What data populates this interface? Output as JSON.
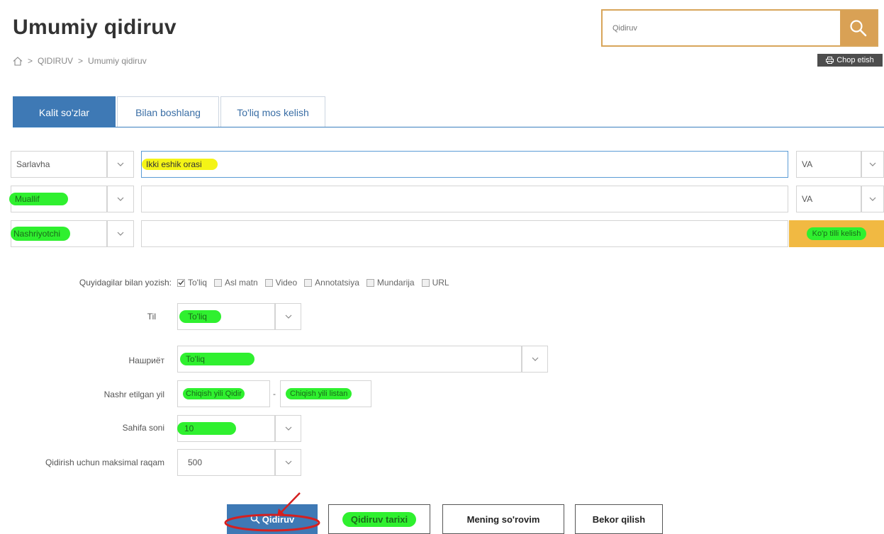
{
  "header": {
    "title": "Umumiy qidiruv",
    "breadcrumb": [
      "QIDIRUV",
      "Umumiy qidiruv"
    ],
    "breadcrumb_sep": ">",
    "search_placeholder": "Qidiruv",
    "print_label": "Chop etish"
  },
  "tabs": [
    {
      "label": "Kalit so'zlar",
      "active": true
    },
    {
      "label": "Bilan boshlang",
      "active": false
    },
    {
      "label": "To'liq mos kelish",
      "active": false
    }
  ],
  "criteria": [
    {
      "field": "Sarlavha",
      "value": "Ikki eshik orasi",
      "operator": "VA"
    },
    {
      "field": "Muallif",
      "value": "",
      "operator": "VA"
    },
    {
      "field": "Nashriyotchi",
      "value": "",
      "operator": "Ko'p tilli kelish"
    }
  ],
  "write_with": {
    "label": "Quyidagilar bilan yozish:",
    "options": [
      {
        "label": "To'liq",
        "checked": true
      },
      {
        "label": "Asl matn",
        "checked": false
      },
      {
        "label": "Video",
        "checked": false
      },
      {
        "label": "Annotatsiya",
        "checked": false
      },
      {
        "label": "Mundarija",
        "checked": false
      },
      {
        "label": "URL",
        "checked": false
      }
    ]
  },
  "til": {
    "label": "Til",
    "value": "To'liq"
  },
  "nashr": {
    "label": "Нашриёт",
    "value": "To'liq"
  },
  "year": {
    "label": "Nashr etilgan yil",
    "from": "Chiqish yili Qidir",
    "sep": "-",
    "to": "Chiqish yili listan"
  },
  "pages": {
    "label": "Sahifa soni",
    "value": "10"
  },
  "max": {
    "label": "Qidirish uchun maksimal raqam",
    "value": "500"
  },
  "buttons": {
    "search": "Qidiruv",
    "history": "Qidiruv tarixi",
    "my_query": "Mening so'rovim",
    "cancel": "Bekor qilish"
  },
  "colors": {
    "accent_blue": "#3e79b5",
    "search_orange": "#d9a155",
    "highlight_green": "#2ff02f",
    "highlight_yellow": "#f4f416",
    "annotation_red": "#d42020"
  }
}
